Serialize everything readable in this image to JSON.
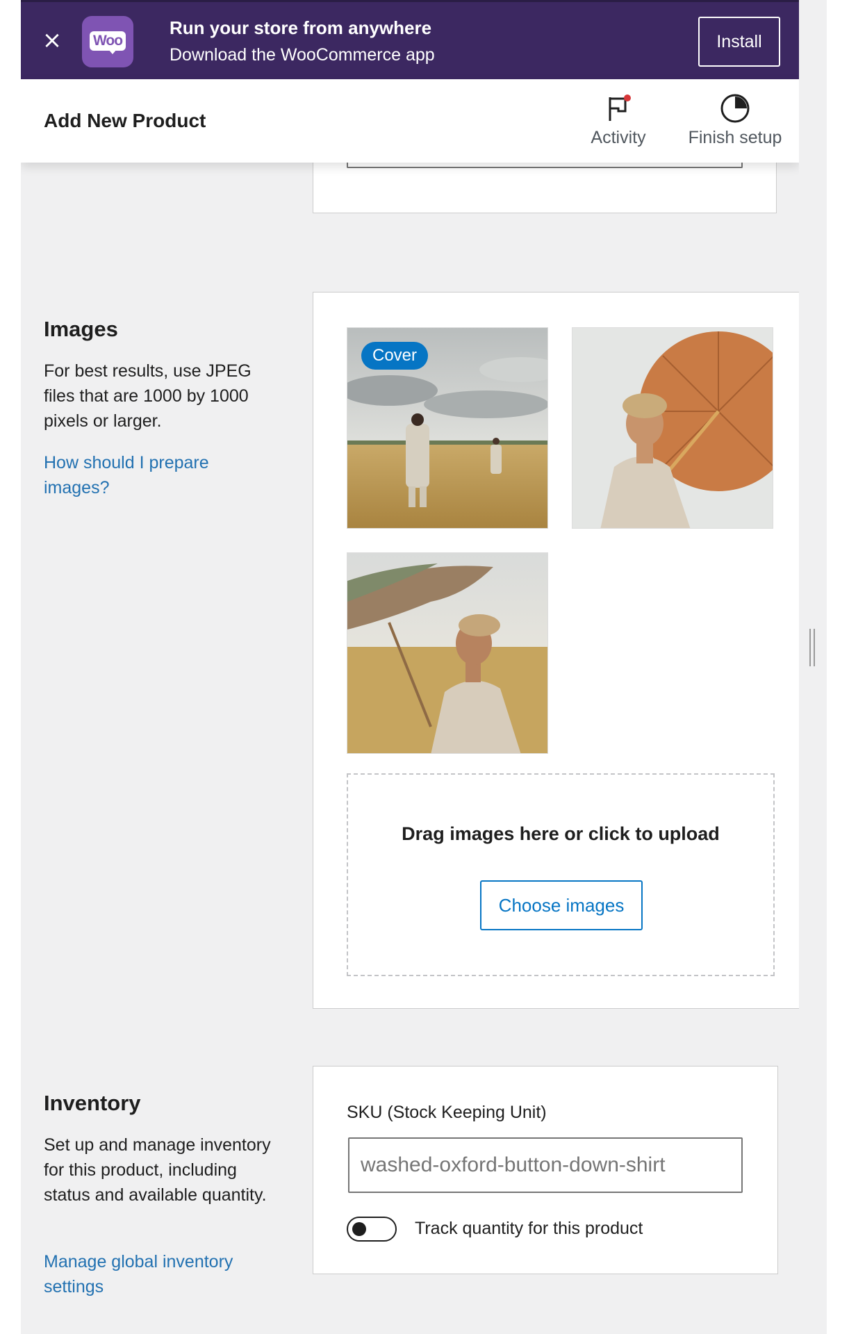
{
  "banner": {
    "title": "Run your store from anywhere",
    "subtitle": "Download the WooCommerce app",
    "install_label": "Install",
    "logo_text": "Woo",
    "close_icon": "×"
  },
  "header": {
    "title": "Add New Product",
    "activity_label": "Activity",
    "finish_setup_label": "Finish setup"
  },
  "images_section": {
    "title": "Images",
    "description": "For best results, use JPEG files that are 1000 by 1000 pixels or larger.",
    "help_link": "How should I prepare images?",
    "cover_badge": "Cover",
    "dropzone_text": "Drag images here or click to upload",
    "choose_button": "Choose images"
  },
  "inventory_section": {
    "title": "Inventory",
    "description": "Set up and manage inventory for this product, including status and available quantity.",
    "manage_link": "Manage global inventory settings",
    "sku_label": "SKU (Stock Keeping Unit)",
    "sku_value": "washed-oxford-button-down-shirt",
    "track_quantity_label": "Track quantity for this product",
    "track_quantity_enabled": false
  },
  "colors": {
    "banner_bg": "#3c2861",
    "woo_purple": "#7f54b3",
    "accent_blue": "#0675c4",
    "link_blue": "#2271b1",
    "notification_red": "#d63638"
  }
}
